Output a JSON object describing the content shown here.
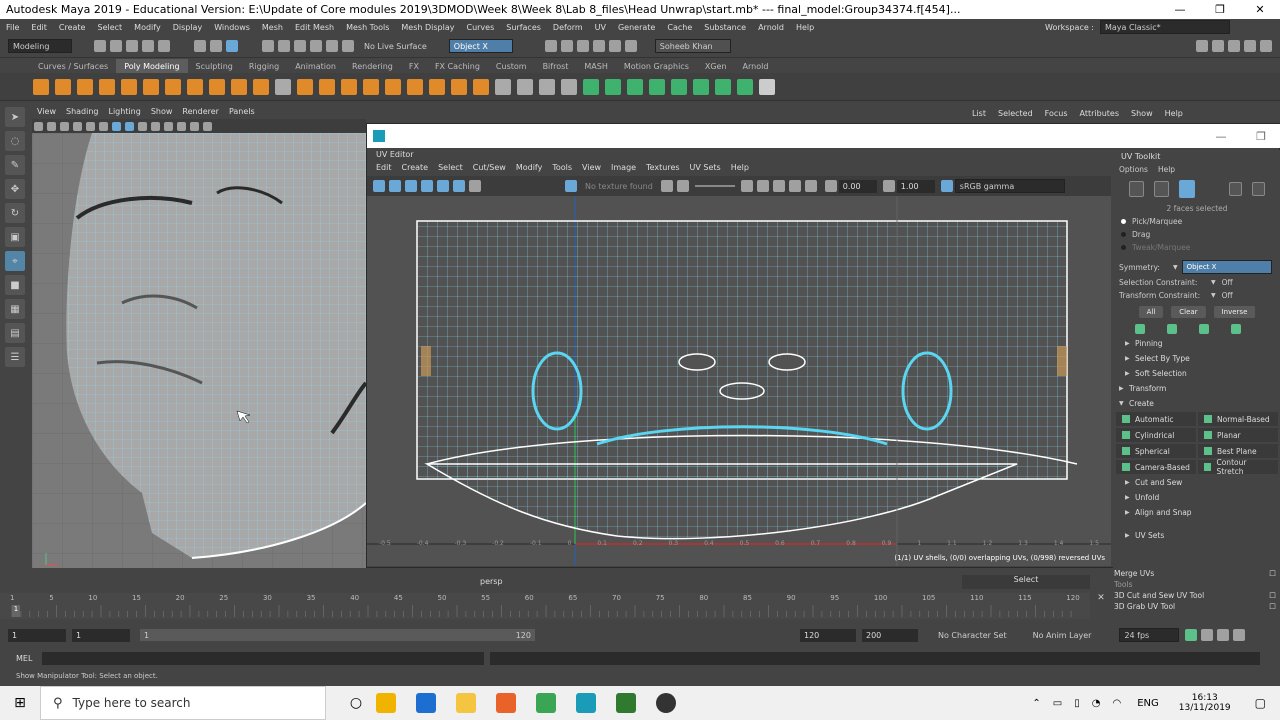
{
  "title": {
    "text": "Autodesk Maya 2019 - Educational Version: E:\\Update of Core modules 2019\\3DMOD\\Week 8\\Week 8\\Lab 8_files\\Head Unwrap\\start.mb*   ---   final_model:Group34374.f[454]...",
    "min": "—",
    "max": "❐",
    "close": "✕"
  },
  "menus": [
    "File",
    "Edit",
    "Create",
    "Select",
    "Modify",
    "Display",
    "Windows",
    "Mesh",
    "Edit Mesh",
    "Mesh Tools",
    "Mesh Display",
    "Curves",
    "Surfaces",
    "Deform",
    "UV",
    "Generate",
    "Cache",
    "Substance",
    "Arnold",
    "Help"
  ],
  "workspace": {
    "label": "Workspace :",
    "value": "Maya Classic*"
  },
  "status": {
    "mode": "Modeling",
    "live_surface": "No Live Surface",
    "symmetry": "Object X",
    "user": "Soheeb Khan"
  },
  "shelf_tabs": [
    "Curves / Surfaces",
    "Poly Modeling",
    "Sculpting",
    "Rigging",
    "Animation",
    "Rendering",
    "FX",
    "FX Caching",
    "Custom",
    "Bifrost",
    "MASH",
    "Motion Graphics",
    "XGen",
    "Arnold"
  ],
  "shelf_active": "Poly Modeling",
  "viewport": {
    "menus": [
      "View",
      "Shading",
      "Lighting",
      "Show",
      "Renderer",
      "Panels"
    ],
    "camera": "persp"
  },
  "attr_menu": [
    "List",
    "Selected",
    "Focus",
    "Attributes",
    "Show",
    "Help"
  ],
  "uv_editor": {
    "caption": "UV Editor",
    "menus": [
      "Edit",
      "Create",
      "Select",
      "Cut/Sew",
      "Modify",
      "Tools",
      "View",
      "Image",
      "Textures",
      "UV Sets",
      "Help"
    ],
    "texture": "No texture found",
    "val1": "0.00",
    "val2": "1.00",
    "colorspace": "sRGB gamma",
    "info": "(1/1) UV shells, (0/0) overlapping UVs, (0/998) reversed UVs",
    "ruler": [
      "-0.5",
      "-0.4",
      "-0.3",
      "-0.2",
      "-0.1",
      "0",
      "0.1",
      "0.2",
      "0.3",
      "0.4",
      "0.5",
      "0.6",
      "0.7",
      "0.8",
      "0.9",
      "1",
      "1.1",
      "1.2",
      "1.3",
      "1.4",
      "1.5"
    ]
  },
  "toolkit": {
    "title": "UV Toolkit",
    "menus": [
      "Options",
      "Help"
    ],
    "faces_selected": "2 faces selected",
    "pick": "Pick/Marquee",
    "drag": "Drag",
    "tweak": "Tweak/Marquee",
    "symmetry_label": "Symmetry:",
    "symmetry_value": "Object X",
    "sel_constraint_label": "Selection Constraint:",
    "sel_constraint_value": "Off",
    "xf_constraint_label": "Transform Constraint:",
    "xf_constraint_value": "Off",
    "btn_all": "All",
    "btn_clear": "Clear",
    "btn_inverse": "Inverse",
    "sections_a": [
      "Pinning",
      "Select By Type",
      "Soft Selection"
    ],
    "transform": "Transform",
    "create": "Create",
    "create_buttons": [
      [
        "Automatic",
        "Normal-Based"
      ],
      [
        "Cylindrical",
        "Planar"
      ],
      [
        "Spherical",
        "Best Plane"
      ],
      [
        "Camera-Based",
        "Contour Stretch"
      ]
    ],
    "sections_b": [
      "Cut and Sew",
      "Unfold",
      "Align and Snap"
    ],
    "uv_sets": "UV Sets",
    "bottom": [
      "Merge UVs",
      "Tools",
      "3D Cut and Sew UV Tool",
      "3D Grab UV Tool"
    ]
  },
  "select_label": "Select",
  "timeline": {
    "ticks": [
      "1",
      "5",
      "10",
      "15",
      "20",
      "25",
      "30",
      "35",
      "40",
      "45",
      "50",
      "55",
      "60",
      "65",
      "70",
      "75",
      "80",
      "85",
      "90",
      "95",
      "100",
      "105",
      "110",
      "115",
      "120"
    ],
    "current": "1"
  },
  "range": {
    "start": "1",
    "start2": "1",
    "slider_start": "1",
    "slider_end": "120",
    "end": "120",
    "end2": "200",
    "char_set": "No Character Set",
    "anim_layer": "No Anim Layer",
    "fps": "24 fps"
  },
  "mel": "MEL",
  "help_line": "Show Manipulator Tool: Select an object.",
  "taskbar": {
    "search": "Type here to search",
    "lang": "ENG",
    "time": "16:13",
    "date": "13/11/2019"
  }
}
